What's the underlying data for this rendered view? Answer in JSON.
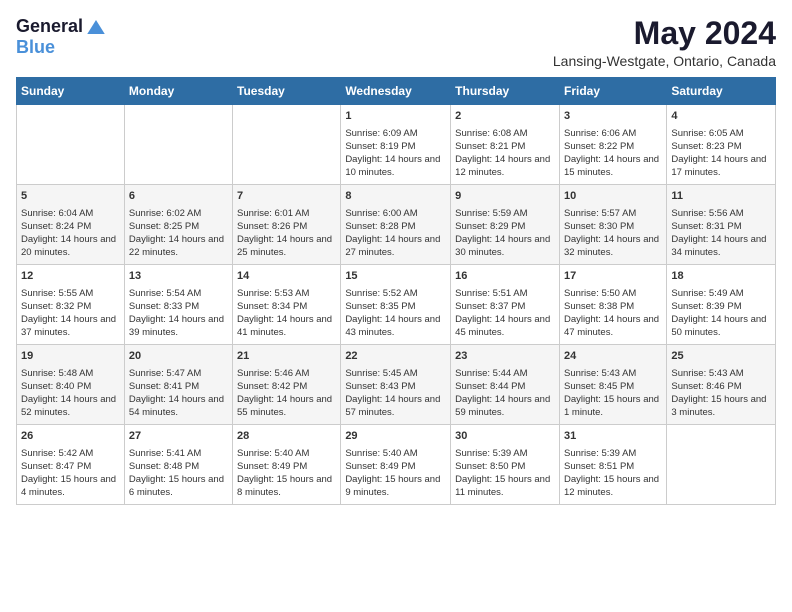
{
  "header": {
    "logo_general": "General",
    "logo_blue": "Blue",
    "month_title": "May 2024",
    "location": "Lansing-Westgate, Ontario, Canada"
  },
  "calendar": {
    "days_of_week": [
      "Sunday",
      "Monday",
      "Tuesday",
      "Wednesday",
      "Thursday",
      "Friday",
      "Saturday"
    ],
    "weeks": [
      [
        {
          "day": "",
          "content": ""
        },
        {
          "day": "",
          "content": ""
        },
        {
          "day": "",
          "content": ""
        },
        {
          "day": "1",
          "content": "Sunrise: 6:09 AM\nSunset: 8:19 PM\nDaylight: 14 hours and 10 minutes."
        },
        {
          "day": "2",
          "content": "Sunrise: 6:08 AM\nSunset: 8:21 PM\nDaylight: 14 hours and 12 minutes."
        },
        {
          "day": "3",
          "content": "Sunrise: 6:06 AM\nSunset: 8:22 PM\nDaylight: 14 hours and 15 minutes."
        },
        {
          "day": "4",
          "content": "Sunrise: 6:05 AM\nSunset: 8:23 PM\nDaylight: 14 hours and 17 minutes."
        }
      ],
      [
        {
          "day": "5",
          "content": "Sunrise: 6:04 AM\nSunset: 8:24 PM\nDaylight: 14 hours and 20 minutes."
        },
        {
          "day": "6",
          "content": "Sunrise: 6:02 AM\nSunset: 8:25 PM\nDaylight: 14 hours and 22 minutes."
        },
        {
          "day": "7",
          "content": "Sunrise: 6:01 AM\nSunset: 8:26 PM\nDaylight: 14 hours and 25 minutes."
        },
        {
          "day": "8",
          "content": "Sunrise: 6:00 AM\nSunset: 8:28 PM\nDaylight: 14 hours and 27 minutes."
        },
        {
          "day": "9",
          "content": "Sunrise: 5:59 AM\nSunset: 8:29 PM\nDaylight: 14 hours and 30 minutes."
        },
        {
          "day": "10",
          "content": "Sunrise: 5:57 AM\nSunset: 8:30 PM\nDaylight: 14 hours and 32 minutes."
        },
        {
          "day": "11",
          "content": "Sunrise: 5:56 AM\nSunset: 8:31 PM\nDaylight: 14 hours and 34 minutes."
        }
      ],
      [
        {
          "day": "12",
          "content": "Sunrise: 5:55 AM\nSunset: 8:32 PM\nDaylight: 14 hours and 37 minutes."
        },
        {
          "day": "13",
          "content": "Sunrise: 5:54 AM\nSunset: 8:33 PM\nDaylight: 14 hours and 39 minutes."
        },
        {
          "day": "14",
          "content": "Sunrise: 5:53 AM\nSunset: 8:34 PM\nDaylight: 14 hours and 41 minutes."
        },
        {
          "day": "15",
          "content": "Sunrise: 5:52 AM\nSunset: 8:35 PM\nDaylight: 14 hours and 43 minutes."
        },
        {
          "day": "16",
          "content": "Sunrise: 5:51 AM\nSunset: 8:37 PM\nDaylight: 14 hours and 45 minutes."
        },
        {
          "day": "17",
          "content": "Sunrise: 5:50 AM\nSunset: 8:38 PM\nDaylight: 14 hours and 47 minutes."
        },
        {
          "day": "18",
          "content": "Sunrise: 5:49 AM\nSunset: 8:39 PM\nDaylight: 14 hours and 50 minutes."
        }
      ],
      [
        {
          "day": "19",
          "content": "Sunrise: 5:48 AM\nSunset: 8:40 PM\nDaylight: 14 hours and 52 minutes."
        },
        {
          "day": "20",
          "content": "Sunrise: 5:47 AM\nSunset: 8:41 PM\nDaylight: 14 hours and 54 minutes."
        },
        {
          "day": "21",
          "content": "Sunrise: 5:46 AM\nSunset: 8:42 PM\nDaylight: 14 hours and 55 minutes."
        },
        {
          "day": "22",
          "content": "Sunrise: 5:45 AM\nSunset: 8:43 PM\nDaylight: 14 hours and 57 minutes."
        },
        {
          "day": "23",
          "content": "Sunrise: 5:44 AM\nSunset: 8:44 PM\nDaylight: 14 hours and 59 minutes."
        },
        {
          "day": "24",
          "content": "Sunrise: 5:43 AM\nSunset: 8:45 PM\nDaylight: 15 hours and 1 minute."
        },
        {
          "day": "25",
          "content": "Sunrise: 5:43 AM\nSunset: 8:46 PM\nDaylight: 15 hours and 3 minutes."
        }
      ],
      [
        {
          "day": "26",
          "content": "Sunrise: 5:42 AM\nSunset: 8:47 PM\nDaylight: 15 hours and 4 minutes."
        },
        {
          "day": "27",
          "content": "Sunrise: 5:41 AM\nSunset: 8:48 PM\nDaylight: 15 hours and 6 minutes."
        },
        {
          "day": "28",
          "content": "Sunrise: 5:40 AM\nSunset: 8:49 PM\nDaylight: 15 hours and 8 minutes."
        },
        {
          "day": "29",
          "content": "Sunrise: 5:40 AM\nSunset: 8:49 PM\nDaylight: 15 hours and 9 minutes."
        },
        {
          "day": "30",
          "content": "Sunrise: 5:39 AM\nSunset: 8:50 PM\nDaylight: 15 hours and 11 minutes."
        },
        {
          "day": "31",
          "content": "Sunrise: 5:39 AM\nSunset: 8:51 PM\nDaylight: 15 hours and 12 minutes."
        },
        {
          "day": "",
          "content": ""
        }
      ]
    ]
  }
}
